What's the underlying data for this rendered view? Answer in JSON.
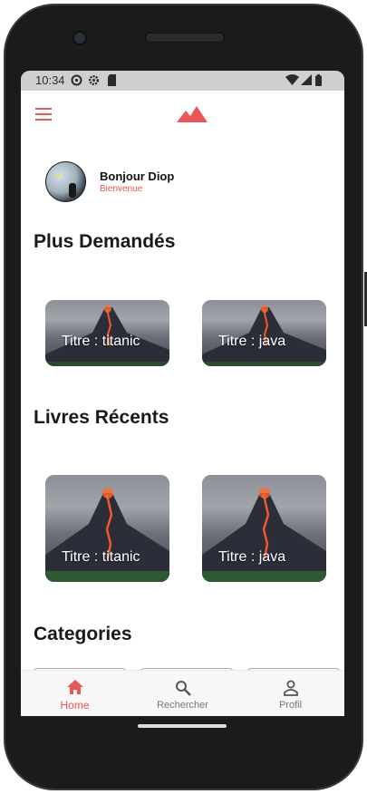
{
  "status_bar": {
    "time": "10:34"
  },
  "header": {
    "menu_icon": "hamburger-menu-icon",
    "logo_icon": "mountain-logo-icon",
    "accent_color": "#e9565a"
  },
  "profile": {
    "greeting": "Bonjour Diop",
    "subtitle": "Bienvenue"
  },
  "sections": {
    "most_requested": {
      "title": "Plus Demandés",
      "items": [
        {
          "label": "Titre : titanic"
        },
        {
          "label": "Titre : java"
        }
      ]
    },
    "recent_books": {
      "title": "Livres Récents",
      "items": [
        {
          "label": "Titre : titanic"
        },
        {
          "label": "Titre : java"
        }
      ]
    },
    "categories": {
      "title": "Categories"
    }
  },
  "bottom_nav": {
    "items": [
      {
        "label": "Home",
        "icon": "home-icon",
        "active": true
      },
      {
        "label": "Rechercher",
        "icon": "search-icon",
        "active": false
      },
      {
        "label": "Profil",
        "icon": "person-icon",
        "active": false
      }
    ]
  }
}
